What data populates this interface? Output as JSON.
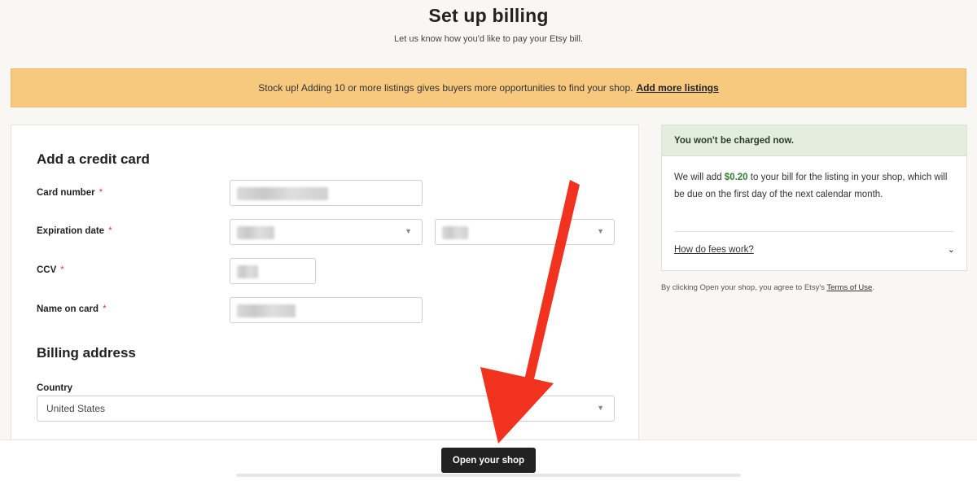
{
  "header": {
    "title": "Set up billing",
    "subtitle": "Let us know how you'd like to pay your Etsy bill."
  },
  "banner": {
    "text": "Stock up! Adding 10 or more listings gives buyers more opportunities to find your shop.",
    "link": "Add more listings"
  },
  "credit_card": {
    "section_title": "Add a credit card",
    "card_number_label": "Card number",
    "expiration_label": "Expiration date",
    "ccv_label": "CCV",
    "name_label": "Name on card",
    "required_mark": "*"
  },
  "billing_address": {
    "section_title": "Billing address",
    "country_label": "Country",
    "country_value": "United States"
  },
  "sidebar": {
    "notice": "You won't be charged now.",
    "fee_text_before": "We will add",
    "fee_amount": "$0.20",
    "fee_text_after": "to your bill for the listing in your shop, which will be due on the first day of the next calendar month.",
    "faq_link": "How do fees work?",
    "terms_before": "By clicking Open your shop, you agree to Etsy's",
    "terms_link": "Terms of Use",
    "terms_after": "."
  },
  "footer": {
    "primary_button": "Open your shop"
  },
  "colors": {
    "banner": "#f7c97f",
    "notice": "#e3efdc",
    "fee_amount": "#2e7d32",
    "annotation_arrow": "#f0321e",
    "primary_button": "#222222"
  },
  "icons": {
    "select_chevron": "chevron-down-icon",
    "faq_chevron": "chevron-down-icon",
    "annotation": "red-arrow-annotation"
  }
}
